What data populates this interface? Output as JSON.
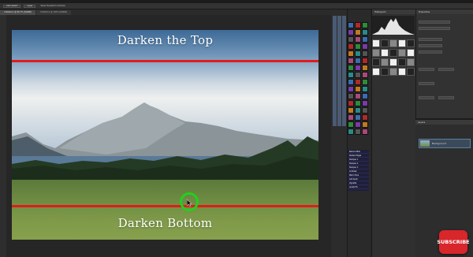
{
  "options_bar": {
    "tool_label": "Auto-Select",
    "layer_mode": "Layer",
    "show_transform": "Show Transform Controls"
  },
  "tabs": [
    {
      "label": "Untitled-1 @ 66.7% (RGB/8)",
      "active": true
    },
    {
      "label": "Untitled-2 @ 100% (RGB/8)",
      "active": false
    }
  ],
  "canvas": {
    "top_caption": "Darken the Top",
    "bottom_caption": "Darken Bottom",
    "guide_color": "#e21b1b",
    "cursor_color": "#20d11e"
  },
  "panels": {
    "histogram_title": "Histogram",
    "properties_title": "Properties",
    "layers_title": "Layers",
    "layer_name": "Background"
  },
  "action_list": [
    "Reduce Mids",
    "Darken Edges",
    "Sharpen 1",
    "Sharpen 2",
    "Sharpen 3",
    "Contrast",
    "Warm Tone",
    "Add Grain",
    "Vignette",
    "Levels Fix"
  ],
  "overlay": {
    "subscribe_label": "SUBSCRIBE",
    "subscribe_color": "#d8262b"
  }
}
